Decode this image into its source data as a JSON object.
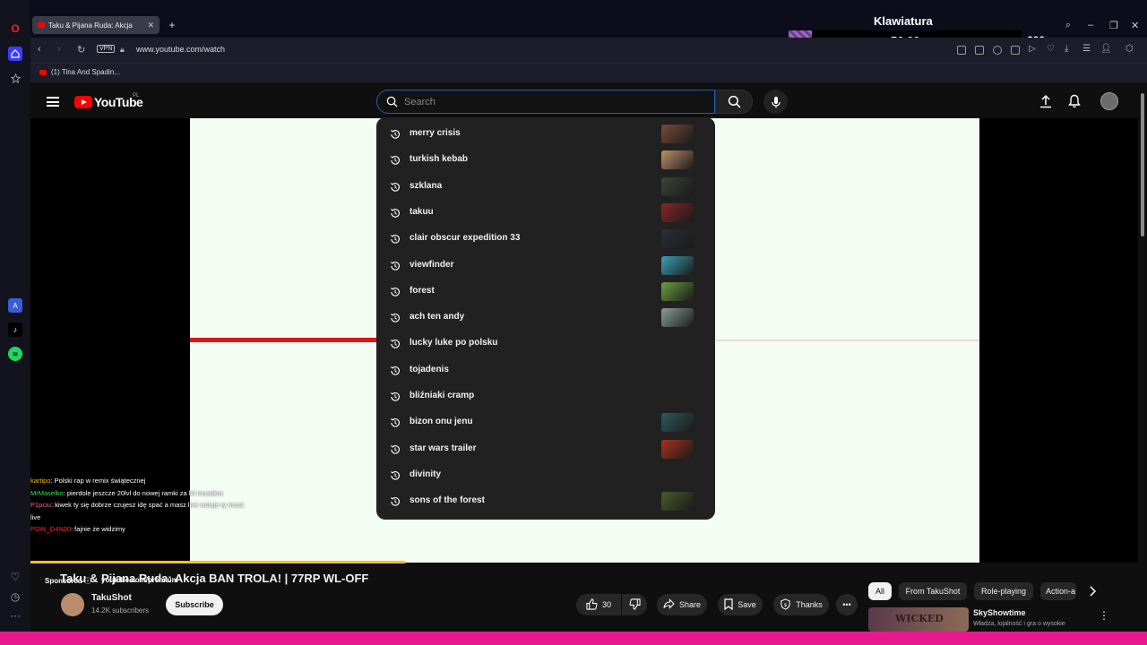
{
  "browser": {
    "tab_title": "Taku & Pijana Ruda: Akcja",
    "url": "www.youtube.com/watch",
    "vpn_label": "VPN",
    "bookmark_1": "(1) Tina And Spadin...",
    "new_tab": "+"
  },
  "overlay": {
    "title": "Klawiatura",
    "value": "56.00",
    "goal": "600"
  },
  "youtube": {
    "logo_text": "YouTube",
    "country": "PL",
    "search_placeholder": "Search"
  },
  "suggestions": [
    {
      "text": "merry crisis",
      "thumb": "#7a4a38"
    },
    {
      "text": "turkish kebab",
      "thumb": "#c0906a"
    },
    {
      "text": "szklana",
      "thumb": "#3c4434"
    },
    {
      "text": "takuu",
      "thumb": "#8a2626"
    },
    {
      "text": "clair obscur expedition 33",
      "thumb": "#2a3038"
    },
    {
      "text": "viewfinder",
      "thumb": "#3aa0b8"
    },
    {
      "text": "forest",
      "thumb": "#6aa040"
    },
    {
      "text": "ach ten andy",
      "thumb": "#8aa098"
    },
    {
      "text": "lucky luke po polsku",
      "thumb": ""
    },
    {
      "text": "tojadenis",
      "thumb": ""
    },
    {
      "text": "bliźniaki cramp",
      "thumb": ""
    },
    {
      "text": "bizon onu jenu",
      "thumb": "#2f5a5a"
    },
    {
      "text": "star wars trailer",
      "thumb": "#a8321a"
    },
    {
      "text": "divinity",
      "thumb": ""
    },
    {
      "text": "sons of the forest",
      "thumb": "#4a5a2a"
    }
  ],
  "chat": [
    {
      "user": "kartipo",
      "msg": ": Polski rap w remix świątecznej"
    },
    {
      "user": "MrMaselko",
      "msg": ": pierdole jeszcze 20lvl do nowej ramki za lvl masakra"
    },
    {
      "user": "P1pciu",
      "msg": ": kiwek ty się dobrze czujesz idę spać a masz live wstaje ty masz live"
    },
    {
      "user": "PDW_D4N00",
      "msg": ": fajnie że widzimy"
    }
  ],
  "ad": {
    "sponsored": "Sponsored",
    "url": "youtube.com/premium"
  },
  "video": {
    "title": "Taku & Pijana Ruda: Akcja BAN TROLA! | 77RP WL-OFF",
    "channel": "TakuShot",
    "subscribers": "14.2K subscribers",
    "subscribe": "Subscribe",
    "likes": "30",
    "share": "Share",
    "save": "Save",
    "thanks": "Thanks"
  },
  "chips": [
    "All",
    "From TakuShot",
    "Role-playing",
    "Action-a"
  ],
  "recommendation": {
    "thumb_text": "WICKED",
    "title": "SkyShowtime",
    "desc": "Władza, lojalność i gra o wysokie"
  }
}
